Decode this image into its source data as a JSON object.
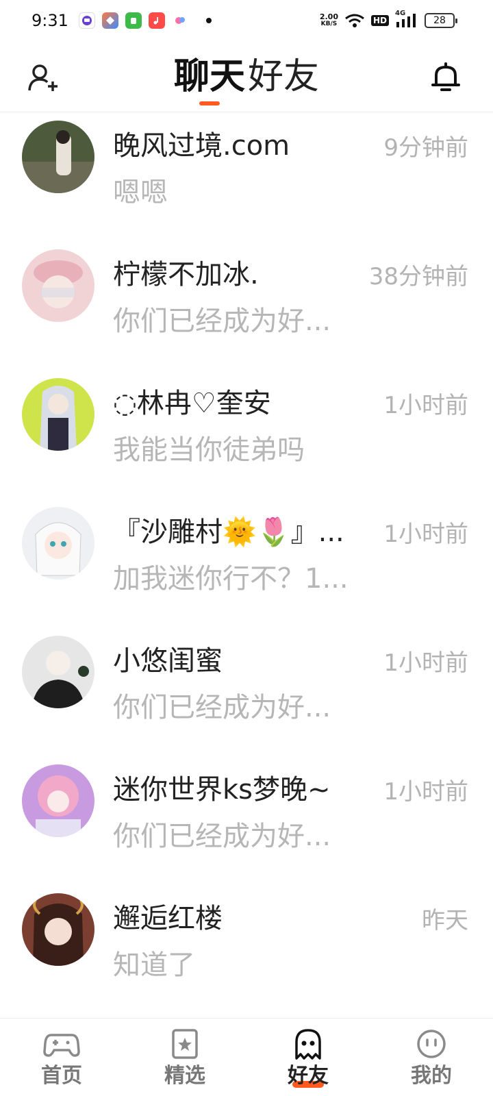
{
  "status_bar": {
    "time": "9:31",
    "net_speed_value": "2.00",
    "net_speed_unit": "KB/S",
    "hd_label": "HD",
    "signal_label": "4G",
    "battery": "28"
  },
  "header": {
    "tabs": [
      {
        "label": "聊天",
        "active": true
      },
      {
        "label": "好友",
        "active": false
      }
    ]
  },
  "chats": [
    {
      "name": "晚风过境.com",
      "time": "9分钟前",
      "preview": "嗯嗯",
      "avatar_color": "#4d5a3c"
    },
    {
      "name": "柠檬不加冰.",
      "time": "38分钟前",
      "preview": "你们已经成为好...",
      "avatar_color": "#e8b7bd"
    },
    {
      "name": "◌林冉♡奎安",
      "time": "1小时前",
      "preview": "我能当你徒弟吗",
      "avatar_color": "#c9e04a"
    },
    {
      "name": "『沙雕村🌞🌷』...",
      "time": "1小时前",
      "preview": "加我迷你行不？1...",
      "avatar_color": "#e7e9ef"
    },
    {
      "name": "小悠闺蜜",
      "time": "1小时前",
      "preview": "你们已经成为好...",
      "avatar_color": "#d9d9d9"
    },
    {
      "name": "迷你世界ks梦晚~",
      "time": "1小时前",
      "preview": "你们已经成为好...",
      "avatar_color": "#d7a6e0"
    },
    {
      "name": "邂逅红楼",
      "time": "昨天",
      "preview": "知道了",
      "avatar_color": "#8a4a3a"
    }
  ],
  "bottom_nav": [
    {
      "label": "首页",
      "icon": "gamepad-icon",
      "active": false
    },
    {
      "label": "精选",
      "icon": "star-icon",
      "active": false
    },
    {
      "label": "好友",
      "icon": "ghost-icon",
      "active": true
    },
    {
      "label": "我的",
      "icon": "smiley-icon",
      "active": false
    }
  ],
  "colors": {
    "accent": "#ff5a1f",
    "muted_text": "#b3b3b3"
  }
}
